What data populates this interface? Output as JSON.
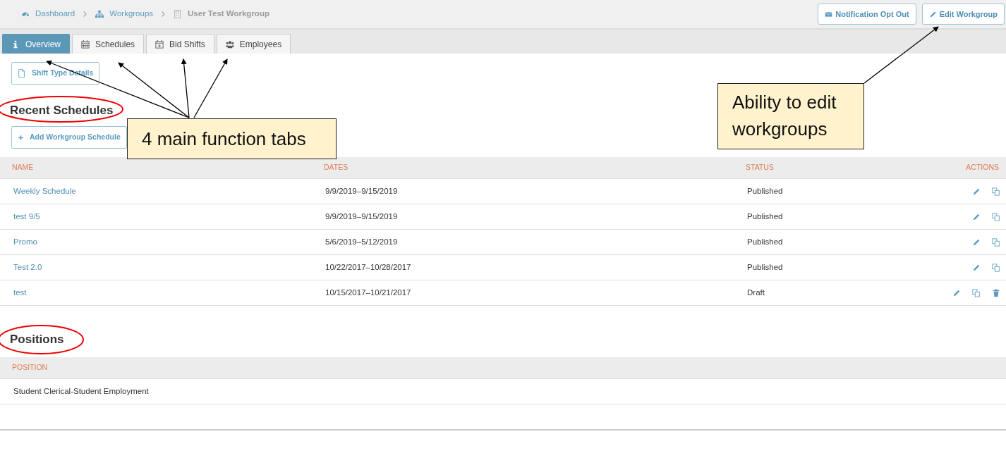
{
  "breadcrumb": [
    {
      "label": "Dashboard",
      "link": true
    },
    {
      "label": "Workgroups",
      "link": true
    },
    {
      "label": "User Test Workgroup",
      "link": false
    }
  ],
  "header_buttons": [
    {
      "label": "Notification Opt Out"
    },
    {
      "label": "Edit Workgroup"
    }
  ],
  "tabs": [
    {
      "label": "Overview",
      "selected": true
    },
    {
      "label": "Schedules",
      "selected": false
    },
    {
      "label": "Bid Shifts",
      "selected": false
    },
    {
      "label": "Employees",
      "selected": false
    }
  ],
  "shift_type_button": {
    "label": "Shift Type Details"
  },
  "recent_schedules": {
    "title": "Recent Schedules",
    "add_button": "Add Workgroup Schedule",
    "columns": [
      "NAME",
      "DATES",
      "STATUS",
      "ACTIONS"
    ],
    "rows": [
      {
        "name": "Weekly Schedule",
        "dates": "9/9/2019–9/15/2019",
        "status": "Published",
        "deletable": false
      },
      {
        "name": "test 9/5",
        "dates": "9/9/2019–9/15/2019",
        "status": "Published",
        "deletable": false
      },
      {
        "name": "Promo",
        "dates": "5/6/2019–5/12/2019",
        "status": "Published",
        "deletable": false
      },
      {
        "name": "Test 2.0",
        "dates": "10/22/2017–10/28/2017",
        "status": "Published",
        "deletable": false
      },
      {
        "name": "test",
        "dates": "10/15/2017–10/21/2017",
        "status": "Draft",
        "deletable": true
      }
    ]
  },
  "positions": {
    "title": "Positions",
    "columns": [
      "POSITION"
    ],
    "rows": [
      {
        "position": "Student Clerical-Student Employment"
      }
    ]
  },
  "annotations": [
    {
      "text": "4 main function tabs"
    },
    {
      "text": "Ability to edit workgroups"
    }
  ]
}
